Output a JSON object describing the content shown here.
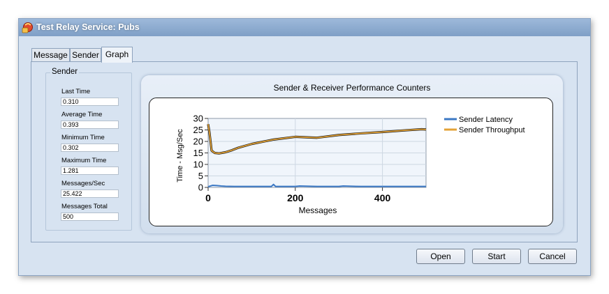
{
  "window": {
    "title": "Test Relay Service: Pubs"
  },
  "tabs": [
    {
      "label": "Message"
    },
    {
      "label": "Sender"
    },
    {
      "label": "Graph",
      "active": true
    }
  ],
  "sender_group": {
    "title": "Sender",
    "stats": [
      {
        "label": "Last Time",
        "value": "0.310"
      },
      {
        "label": "Average Time",
        "value": "0.393"
      },
      {
        "label": "Minimum Time",
        "value": "0.302"
      },
      {
        "label": "Maximum Time",
        "value": "1.281"
      },
      {
        "label": "Messages/Sec",
        "value": "25.422"
      },
      {
        "label": "Messages Total",
        "value": "500"
      }
    ]
  },
  "chart_data": {
    "type": "line",
    "title": "Sender & Receiver Performance Counters",
    "xlabel": "Messages",
    "ylabel": "Time - Msg/Sec",
    "xlim": [
      0,
      500
    ],
    "ylim": [
      0,
      30
    ],
    "x_ticks": [
      0,
      200,
      400
    ],
    "y_ticks": [
      0,
      5,
      10,
      15,
      20,
      25,
      30
    ],
    "grid": true,
    "legend_position": "right",
    "series": [
      {
        "name": "Sender Latency",
        "color": "#3b78c4",
        "x": [
          0,
          5,
          10,
          20,
          30,
          40,
          60,
          100,
          145,
          150,
          155,
          200,
          210,
          250,
          300,
          310,
          350,
          400,
          450,
          500
        ],
        "y": [
          0.3,
          0.6,
          0.9,
          0.8,
          0.6,
          0.5,
          0.4,
          0.4,
          0.4,
          1.3,
          0.4,
          0.4,
          0.6,
          0.4,
          0.4,
          0.6,
          0.4,
          0.4,
          0.4,
          0.4
        ]
      },
      {
        "name": "Sender Throughput",
        "color": "#e3a236",
        "x": [
          0,
          3,
          8,
          15,
          25,
          40,
          55,
          70,
          100,
          150,
          200,
          250,
          300,
          350,
          400,
          450,
          490,
          500
        ],
        "y": [
          27.5,
          24,
          16,
          15,
          14.8,
          15.3,
          16.2,
          17.3,
          18.9,
          20.8,
          22.0,
          21.6,
          22.8,
          23.5,
          24.1,
          24.8,
          25.3,
          25.2
        ]
      }
    ]
  },
  "buttons": {
    "open": "Open",
    "start": "Start",
    "cancel": "Cancel"
  }
}
